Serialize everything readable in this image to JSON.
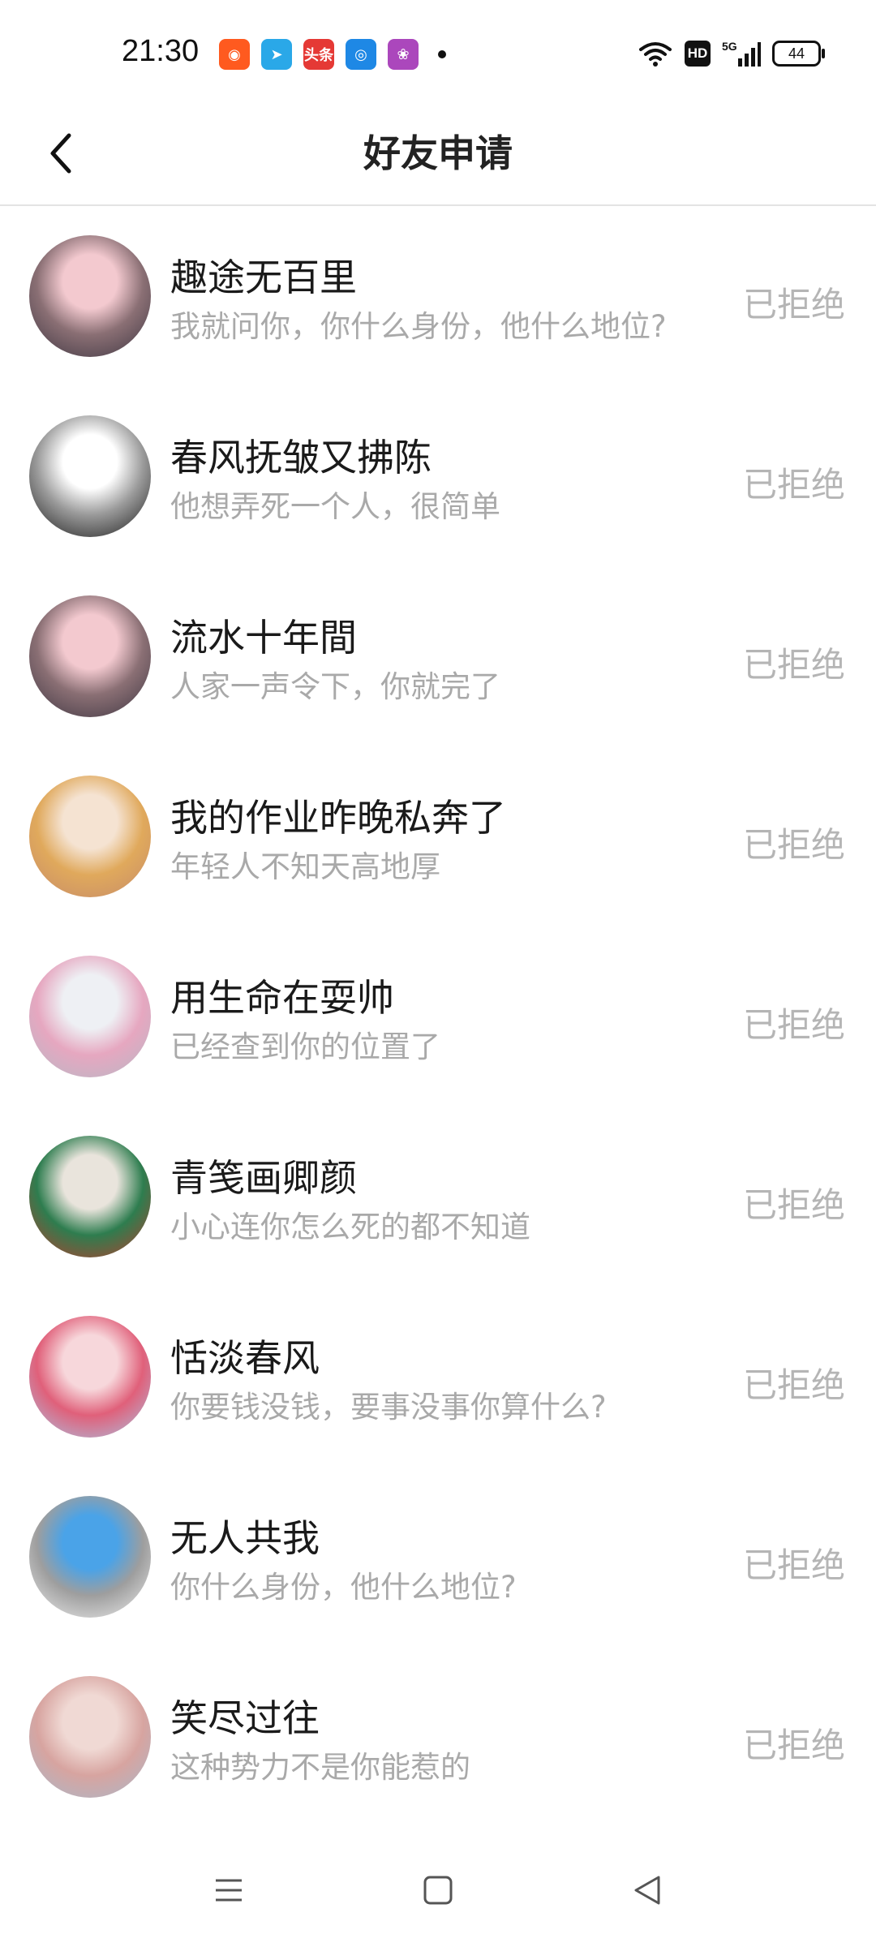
{
  "status_bar": {
    "time": "21:30",
    "apps": [
      {
        "icon": "kuaishou-icon",
        "color": "#ff5a1f",
        "glyph": "◉"
      },
      {
        "icon": "telegram-like-icon",
        "color": "#2aa8e8",
        "glyph": "➤"
      },
      {
        "icon": "toutiao-icon",
        "color": "#e53935",
        "glyph": "头条"
      },
      {
        "icon": "browser-icon",
        "color": "#1e88e5",
        "glyph": "◎"
      },
      {
        "icon": "game-icon",
        "color": "#ab47bc",
        "glyph": "❀"
      }
    ],
    "hd": "HD",
    "network": "5G",
    "battery": "44"
  },
  "header": {
    "title": "好友申请"
  },
  "requests": [
    {
      "name": "趣途无百里",
      "message": "我就问你，你什么身份，他什么地位?",
      "status": "已拒绝",
      "avatar_colors": [
        "#f3c9cf",
        "#8a6f74",
        "#3b3440"
      ]
    },
    {
      "name": "春风抚皱又拂陈",
      "message": "他想弄死一个人，很简单",
      "status": "已拒绝",
      "avatar_colors": [
        "#ffffff",
        "#9a9a9a",
        "#151515"
      ]
    },
    {
      "name": "流水十年間",
      "message": "人家一声令下，你就完了",
      "status": "已拒绝",
      "avatar_colors": [
        "#f3c9cf",
        "#8a6f74",
        "#3b3440"
      ]
    },
    {
      "name": "我的作业昨晚私奔了",
      "message": "年轻人不知天高地厚",
      "status": "已拒绝",
      "avatar_colors": [
        "#f5e3d2",
        "#e0a95c",
        "#c58a6a"
      ]
    },
    {
      "name": "用生命在耍帅",
      "message": "已经查到你的位置了",
      "status": "已拒绝",
      "avatar_colors": [
        "#eef0f4",
        "#e6a7c0",
        "#b5b9c6"
      ]
    },
    {
      "name": "青笺画卿颜",
      "message": "小心连你怎么死的都不知道",
      "status": "已拒绝",
      "avatar_colors": [
        "#e9e4dc",
        "#2e7d4f",
        "#c0392b"
      ]
    },
    {
      "name": "恬淡春风",
      "message": "你要钱没钱，要事没事你算什么?",
      "status": "已拒绝",
      "avatar_colors": [
        "#f7d7db",
        "#e0607a",
        "#a6c8e8"
      ]
    },
    {
      "name": "无人共我",
      "message": "你什么身份，他什么地位?",
      "status": "已拒绝",
      "avatar_colors": [
        "#4aa3e8",
        "#9e9e9e",
        "#f2f2f2"
      ]
    },
    {
      "name": "笑尽过往",
      "message": "这种势力不是你能惹的",
      "status": "已拒绝",
      "avatar_colors": [
        "#f0d9d4",
        "#d7a4a0",
        "#a7b9cc"
      ]
    }
  ]
}
